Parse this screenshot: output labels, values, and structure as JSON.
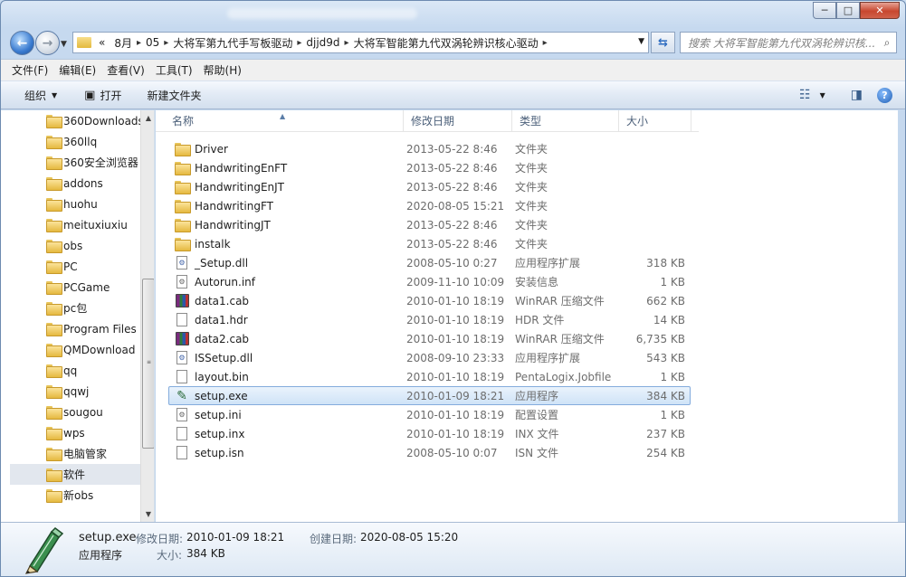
{
  "window": {
    "buttons": {
      "minimize": "─",
      "maximize": "□",
      "close": "✕"
    }
  },
  "address": {
    "overflow": "«",
    "crumbs": [
      "8月",
      "05",
      "大将军第九代手写板驱动",
      "djjd9d",
      "大将军智能第九代双涡轮辨识核心驱动"
    ],
    "search_placeholder": "搜索 大将军智能第九代双涡轮辨识核..."
  },
  "menu": [
    "文件(F)",
    "编辑(E)",
    "查看(V)",
    "工具(T)",
    "帮助(H)"
  ],
  "toolbar": {
    "organize": "组织",
    "open": "打开",
    "new_folder": "新建文件夹"
  },
  "nav": {
    "items": [
      "360Downloads",
      "360llq",
      "360安全浏览器",
      "addons",
      "huohu",
      "meituxiuxiu",
      "obs",
      "PC",
      "PCGame",
      "pc包",
      "Program Files",
      "QMDownload",
      "qq",
      "qqwj",
      "sougou",
      "wps",
      "电脑管家",
      "软件",
      "新obs"
    ],
    "selected_index": 17
  },
  "columns": {
    "name": "名称",
    "date": "修改日期",
    "type": "类型",
    "size": "大小"
  },
  "files": [
    {
      "name": "Driver",
      "date": "2013-05-22 8:46",
      "type": "文件夹",
      "size": "",
      "icon": "folder-icon"
    },
    {
      "name": "HandwritingEnFT",
      "date": "2013-05-22 8:46",
      "type": "文件夹",
      "size": "",
      "icon": "folder-icon"
    },
    {
      "name": "HandwritingEnJT",
      "date": "2013-05-22 8:46",
      "type": "文件夹",
      "size": "",
      "icon": "folder-icon"
    },
    {
      "name": "HandwritingFT",
      "date": "2020-08-05 15:21",
      "type": "文件夹",
      "size": "",
      "icon": "folder-icon"
    },
    {
      "name": "HandwritingJT",
      "date": "2013-05-22 8:46",
      "type": "文件夹",
      "size": "",
      "icon": "folder-icon"
    },
    {
      "name": "instalk",
      "date": "2013-05-22 8:46",
      "type": "文件夹",
      "size": "",
      "icon": "folder-icon"
    },
    {
      "name": "_Setup.dll",
      "date": "2008-05-10 0:27",
      "type": "应用程序扩展",
      "size": "318 KB",
      "icon": "dll-file-icon"
    },
    {
      "name": "Autorun.inf",
      "date": "2009-11-10 10:09",
      "type": "安装信息",
      "size": "1 KB",
      "icon": "settings-file-icon"
    },
    {
      "name": "data1.cab",
      "date": "2010-01-10 18:19",
      "type": "WinRAR 压缩文件",
      "size": "662 KB",
      "icon": "winrar-archive-icon"
    },
    {
      "name": "data1.hdr",
      "date": "2010-01-10 18:19",
      "type": "HDR 文件",
      "size": "14 KB",
      "icon": "blank-file-icon"
    },
    {
      "name": "data2.cab",
      "date": "2010-01-10 18:19",
      "type": "WinRAR 压缩文件",
      "size": "6,735 KB",
      "icon": "winrar-archive-icon"
    },
    {
      "name": "ISSetup.dll",
      "date": "2008-09-10 23:33",
      "type": "应用程序扩展",
      "size": "543 KB",
      "icon": "dll-file-icon"
    },
    {
      "name": "layout.bin",
      "date": "2010-01-10 18:19",
      "type": "PentaLogix.Jobfile",
      "size": "1 KB",
      "icon": "blank-file-icon"
    },
    {
      "name": "setup.exe",
      "date": "2010-01-09 18:21",
      "type": "应用程序",
      "size": "384 KB",
      "icon": "pen-app-icon"
    },
    {
      "name": "setup.ini",
      "date": "2010-01-10 18:19",
      "type": "配置设置",
      "size": "1 KB",
      "icon": "settings-file-icon"
    },
    {
      "name": "setup.inx",
      "date": "2010-01-10 18:19",
      "type": "INX 文件",
      "size": "237 KB",
      "icon": "blank-file-icon"
    },
    {
      "name": "setup.isn",
      "date": "2008-05-10 0:07",
      "type": "ISN 文件",
      "size": "254 KB",
      "icon": "blank-file-icon"
    }
  ],
  "selected_file_index": 13,
  "details": {
    "name": "setup.exe",
    "kind": "应用程序",
    "modified_label": "修改日期:",
    "modified": "2010-01-09 18:21",
    "created_label": "创建日期:",
    "created": "2020-08-05 15:20",
    "size_label": "大小:",
    "size": "384 KB"
  }
}
